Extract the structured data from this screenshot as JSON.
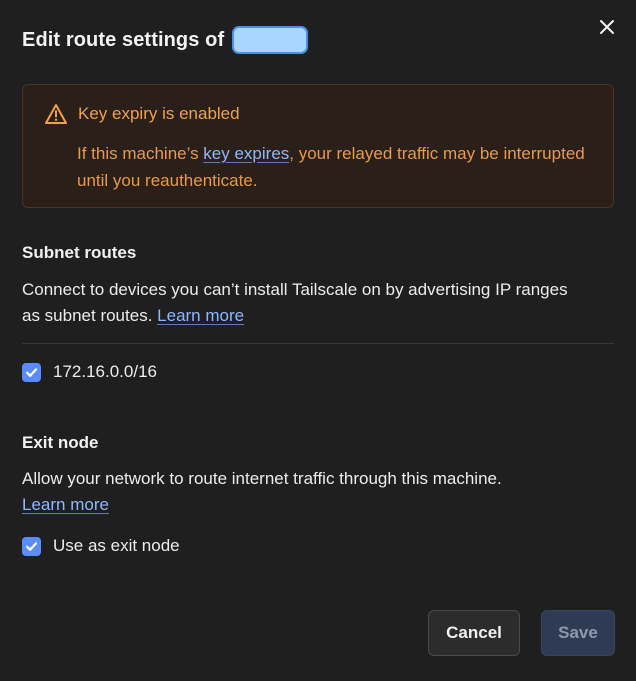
{
  "dialog": {
    "title": "Edit route settings of",
    "close_icon": "close-icon"
  },
  "warning": {
    "icon": "warning-triangle-icon",
    "title": "Key expiry is enabled",
    "text_before": "If this machine’s ",
    "link": "key expires",
    "text_after": ", your relayed traffic may be interrupted until you reauthenticate."
  },
  "subnet_routes": {
    "title": "Subnet routes",
    "description": "Connect to devices you can’t install Tailscale on by advertising IP ranges as subnet routes.",
    "learn_more": "Learn more",
    "routes": [
      {
        "label": "172.16.0.0/16",
        "checked": true
      }
    ]
  },
  "exit_node": {
    "title": "Exit node",
    "description": "Allow your network to route internet traffic through this machine.",
    "learn_more": "Learn more",
    "option": {
      "label": "Use as exit node",
      "checked": true
    }
  },
  "footer": {
    "cancel_label": "Cancel",
    "save_label": "Save"
  },
  "colors": {
    "background": "#1f1f1f",
    "warning_text": "#e89a48",
    "link": "#8fb7ff",
    "checkbox": "#5a8cff",
    "save_disabled_bg": "#2f3b52"
  }
}
